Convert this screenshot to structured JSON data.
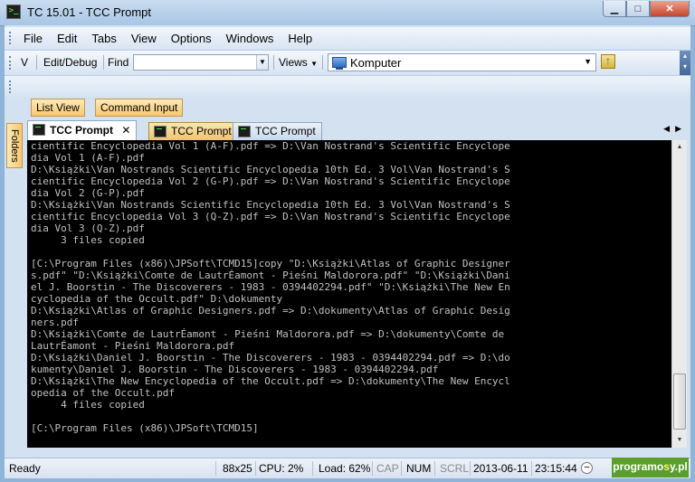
{
  "window": {
    "title": "TC 15.01 - TCC Prompt",
    "app_icon_glyph": ">_"
  },
  "window_controls": {
    "minimize": "▁",
    "maximize": "□",
    "close": "✕"
  },
  "menu": [
    {
      "label": "File"
    },
    {
      "label": "Edit"
    },
    {
      "label": "Tabs"
    },
    {
      "label": "View"
    },
    {
      "label": "Options"
    },
    {
      "label": "Windows"
    },
    {
      "label": "Help"
    }
  ],
  "toolbar": {
    "v_label": "V",
    "edit_debug_label": "Edit/Debug",
    "find_label": "Find",
    "find_value": "",
    "views_label": "Views",
    "location_value": "Komputer",
    "dropdown_glyph": "▼"
  },
  "panes": {
    "list_view": "List View",
    "command_input": "Command Input",
    "folders": "Folders"
  },
  "tabs": [
    {
      "label": "TCC Prompt",
      "active": true
    },
    {
      "label": "TCC Prompt",
      "active": false
    },
    {
      "label": "TCC Prompt",
      "active": false
    }
  ],
  "tab_close_glyph": "✕",
  "tab_nav_glyphs": "◀▶",
  "console_lines": [
    "cientific Encyclopedia Vol 1 (A-F).pdf => D:\\Van Nostrand's Scientific Encyclope",
    "dia Vol 1 (A-F).pdf",
    "D:\\Książki\\Van Nostrands Scientific Encyclopedia 10th Ed. 3 Vol\\Van Nostrand's S",
    "cientific Encyclopedia Vol 2 (G-P).pdf => D:\\Van Nostrand's Scientific Encyclope",
    "dia Vol 2 (G-P).pdf",
    "D:\\Książki\\Van Nostrands Scientific Encyclopedia 10th Ed. 3 Vol\\Van Nostrand's S",
    "cientific Encyclopedia Vol 3 (Q-Z).pdf => D:\\Van Nostrand's Scientific Encyclope",
    "dia Vol 3 (Q-Z).pdf",
    "     3 files copied",
    "",
    "[C:\\Program Files (x86)\\JPSoft\\TCMD15]copy \"D:\\Książki\\Atlas of Graphic Designer",
    "s.pdf\" \"D:\\Książki\\Comte de LautrÉamont - Pieśni Maldorora.pdf\" \"D:\\Książki\\Dani",
    "el J. Boorstin - The Discoverers - 1983 - 0394402294.pdf\" \"D:\\Książki\\The New En",
    "cyclopedia of the Occult.pdf\" D:\\dokumenty",
    "D:\\Książki\\Atlas of Graphic Designers.pdf => D:\\dokumenty\\Atlas of Graphic Desig",
    "ners.pdf",
    "D:\\Książki\\Comte de LautrÉamont - Pieśni Maldorora.pdf => D:\\dokumenty\\Comte de",
    "LautrÉamont - Pieśni Maldorora.pdf",
    "D:\\Książki\\Daniel J. Boorstin - The Discoverers - 1983 - 0394402294.pdf => D:\\do",
    "kumenty\\Daniel J. Boorstin - The Discoverers - 1983 - 0394402294.pdf",
    "D:\\Książki\\The New Encyclopedia of the Occult.pdf => D:\\dokumenty\\The New Encycl",
    "opedia of the Occult.pdf",
    "     4 files copied",
    "",
    "[C:\\Program Files (x86)\\JPSoft\\TCMD15]"
  ],
  "scrollbar": {
    "up": "▲",
    "down": "▼",
    "position": 0.92
  },
  "status": {
    "ready": "Ready",
    "size": "88x25",
    "cpu": "CPU:  2%",
    "load": "Load: 62%",
    "cap": "CAP",
    "num": "NUM",
    "scrl": "SCRL",
    "date": "2013-06-11",
    "time": "23:15:44",
    "zoom_minus": "−"
  },
  "watermark": {
    "part1": "programo",
    "part2": "s",
    "part3": "y.pl"
  },
  "colors": {
    "console_bg": "#000000",
    "console_fg": "#c0c0c0",
    "tab_alt": "#f2c36d",
    "brand": "#5a9e2c"
  }
}
